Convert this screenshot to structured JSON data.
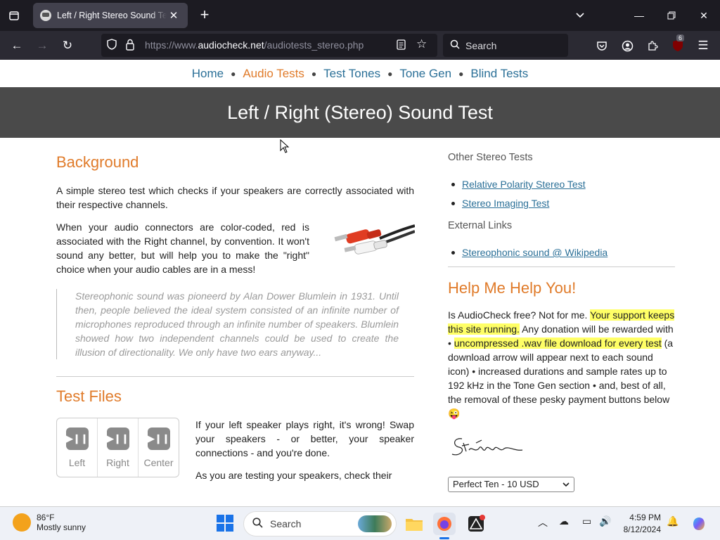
{
  "browser": {
    "tab_title": "Left / Right Stereo Sound Test (",
    "url_prefix": "https://www.",
    "url_domain": "audiocheck.net",
    "url_path": "/audiotests_stereo.php",
    "search_placeholder": "Search",
    "extension_badge": "6"
  },
  "nav": {
    "items": [
      "Home",
      "Audio Tests",
      "Test Tones",
      "Tone Gen",
      "Blind Tests"
    ],
    "active_index": 1
  },
  "hero_title": "Left / Right (Stereo) Sound Test",
  "background": {
    "heading": "Background",
    "p1": "A simple stereo test which checks if your speakers are correctly associated with their respective channels.",
    "p2": "When your audio connectors are color-coded, red is associated with the Right channel, by convention. It won't sound any better, but will help you to make the \"right\" choice when your audio cables are in a mess!",
    "quote": "Stereophonic sound was pioneerd by Alan Dower Blumlein in 1931. Until then, people believed the ideal system consisted of an infinite number of microphones reproduced through an infinite number of speakers. Blumlein showed how two independent channels could be used to create the illusion of directionality. We only have two ears anyway..."
  },
  "test_files": {
    "heading": "Test Files",
    "players": [
      "Left",
      "Right",
      "Center"
    ],
    "p1": "If your left speaker plays right, it's wrong! Swap your speakers - or better, your speaker connections - and you're done.",
    "p2": "As you are testing your speakers, check their"
  },
  "sidebar": {
    "other_heading": "Other Stereo Tests",
    "other_links": [
      "Relative Polarity Stereo Test",
      "Stereo Imaging Test"
    ],
    "external_heading": "External Links",
    "external_links": [
      "Stereophonic sound @ Wikipedia"
    ],
    "help_heading": "Help Me Help You!",
    "help_t1": "Is AudioCheck free? Not for me. ",
    "help_hl1": "Your support keeps this site running.",
    "help_t2": " Any donation will be rewarded with • ",
    "help_hl2": "uncompressed .wav file download for every test",
    "help_t3": " (a download arrow will appear next to each sound icon) • increased durations and sample rates up to 192 kHz in the Tone Gen section • and, best of all, the removal of these pesky payment buttons below 😜",
    "signature": "Stéphane",
    "donate_option": "Perfect Ten - 10 USD"
  },
  "taskbar": {
    "temp": "86°F",
    "weather": "Mostly sunny",
    "search": "Search",
    "time": "4:59 PM",
    "date": "8/12/2024"
  },
  "colors": {
    "accent_orange": "#e07b2a",
    "link_blue": "#2a6f97",
    "highlight": "#ffff66"
  }
}
